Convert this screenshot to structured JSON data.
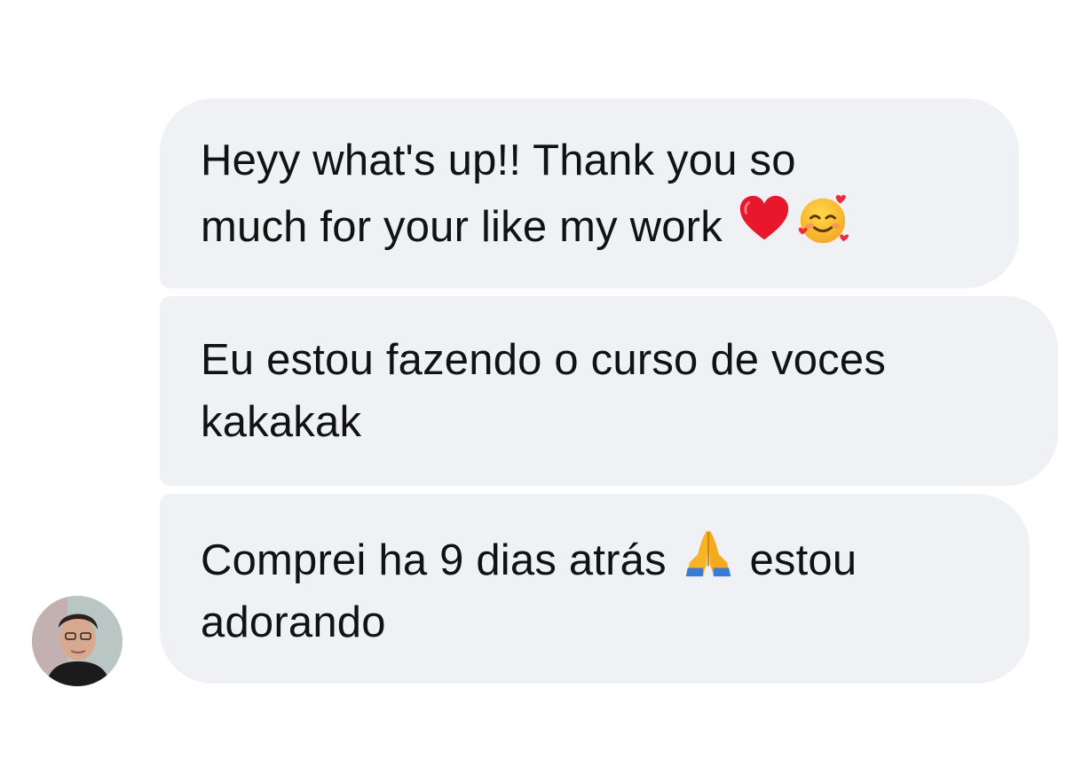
{
  "messages": [
    {
      "line1": "Heyy what's up!! Thank you so",
      "line2": "much for your like my work",
      "emojis": [
        "red-heart-emoji",
        "smiling-face-with-hearts-emoji"
      ]
    },
    {
      "line1": "Eu estou fazendo o curso de voces",
      "line2": "kakakak"
    },
    {
      "line1_before": "Comprei ha 9 dias atrás",
      "line1_after": "estou",
      "line2": "adorando",
      "emojis": [
        "folded-hands-emoji"
      ]
    }
  ],
  "colors": {
    "bubble_bg": "#f0f1f4",
    "text": "#121212",
    "background": "#ffffff"
  }
}
